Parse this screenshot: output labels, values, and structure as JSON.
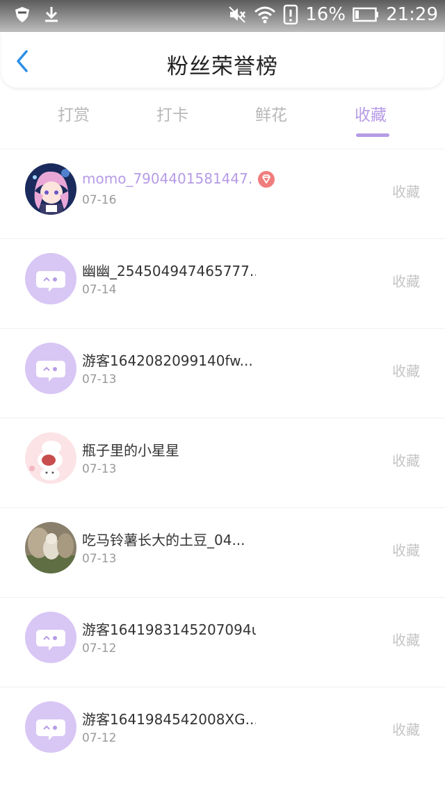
{
  "status_bar": {
    "battery": "16%",
    "time": "21:29"
  },
  "header": {
    "title": "粉丝荣誉榜"
  },
  "tabs": [
    {
      "label": "打赏",
      "active": false
    },
    {
      "label": "打卡",
      "active": false
    },
    {
      "label": "鲜花",
      "active": false
    },
    {
      "label": "收藏",
      "active": true
    }
  ],
  "colors": {
    "accent": "#b69be6",
    "default_avatar": "#d8c6f5",
    "vip_badge": "#f07d7d"
  },
  "fans": [
    {
      "name": "momo_7904401581447.",
      "date": "07-16",
      "action": "收藏",
      "avatar": "anime-avatar",
      "vip": true
    },
    {
      "name": "幽幽_254504947465777...",
      "date": "07-14",
      "action": "收藏",
      "avatar": "default-chat-avatar",
      "vip": false
    },
    {
      "name": "游客1642082099140fw...",
      "date": "07-13",
      "action": "收藏",
      "avatar": "default-chat-avatar",
      "vip": false
    },
    {
      "name": "瓶子里的小星星",
      "date": "07-13",
      "action": "收藏",
      "avatar": "pink-cartoon-avatar",
      "vip": false
    },
    {
      "name": "吃马铃薯长大的土豆_04...",
      "date": "07-13",
      "action": "收藏",
      "avatar": "photo-avatar",
      "vip": false
    },
    {
      "name": "游客1641983145207094u",
      "date": "07-12",
      "action": "收藏",
      "avatar": "default-chat-avatar",
      "vip": false
    },
    {
      "name": "游客1641984542008XG...",
      "date": "07-12",
      "action": "收藏",
      "avatar": "default-chat-avatar",
      "vip": false
    }
  ]
}
